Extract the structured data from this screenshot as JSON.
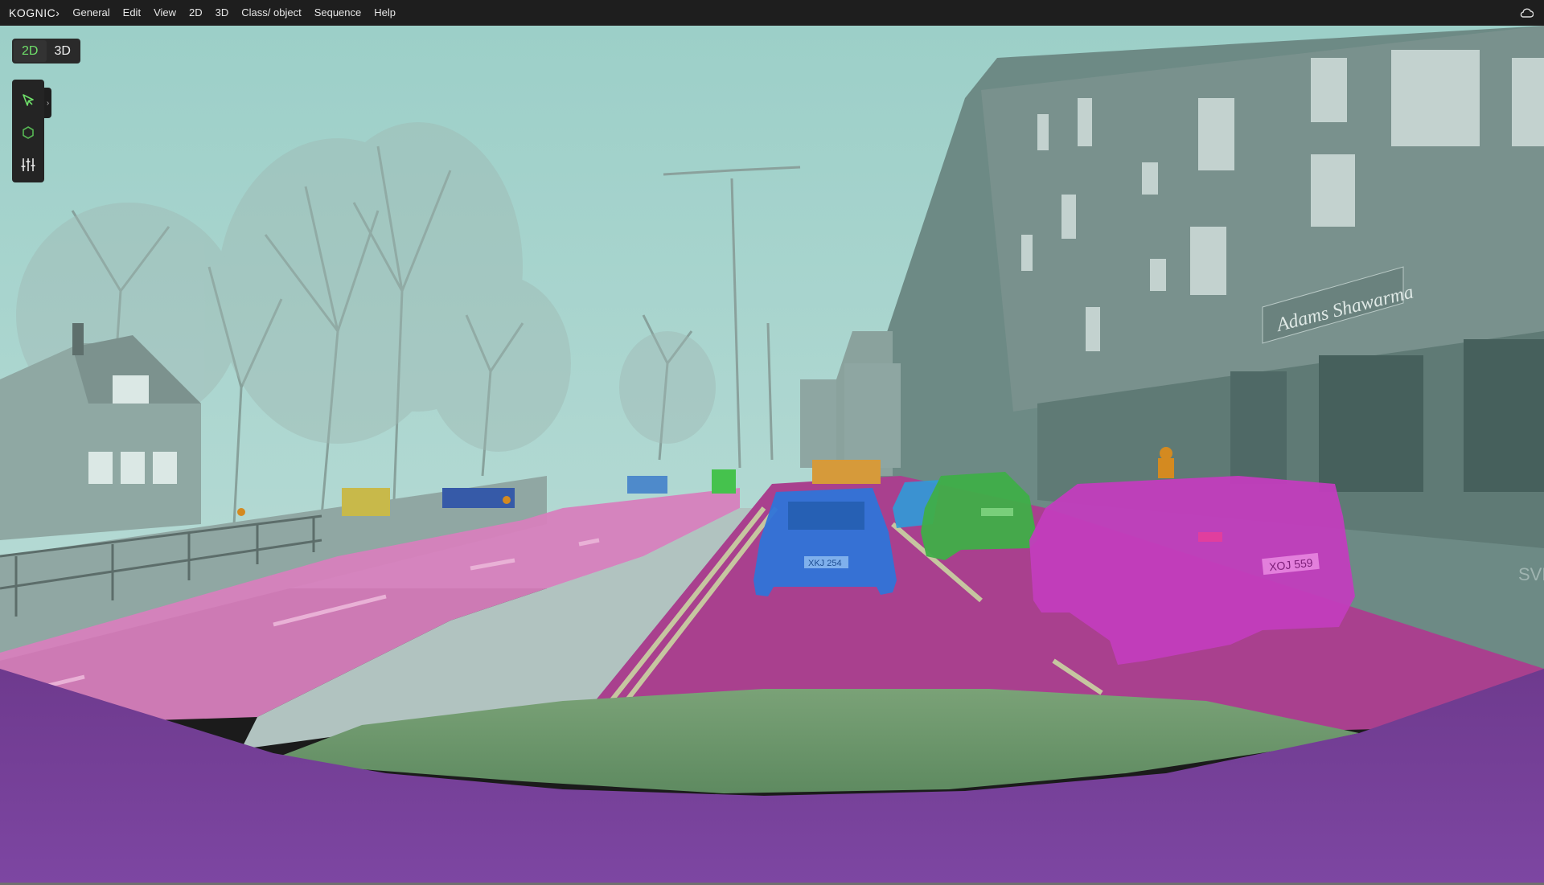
{
  "app": {
    "logo_text": "KOGNIC",
    "menu": [
      "General",
      "Edit",
      "View",
      "2D",
      "3D",
      "Class/ object",
      "Sequence",
      "Help"
    ],
    "cloud_icon": "cloud-icon"
  },
  "mode_toggle": {
    "options": [
      "2D",
      "3D"
    ],
    "active": "2D",
    "active_color": "#6fe06a"
  },
  "tools": [
    {
      "name": "select-tool",
      "icon": "cursor-arrow-icon",
      "active": true
    },
    {
      "name": "polygon-tool",
      "icon": "hexagon-icon",
      "active": false
    },
    {
      "name": "adjust-tool",
      "icon": "sliders-icon",
      "active": false
    }
  ],
  "scene": {
    "description_colors": {
      "sky_overlay": "#a8d6d0",
      "road_pink": "#d678b8",
      "lane_magenta": "#a53a86",
      "ego_purple": "#7b3f9a",
      "hood_green": "#6f9a6c",
      "car_blue": "#2f74d8",
      "car_green": "#3fae48",
      "car_magenta": "#c23dbd",
      "building_tint": "#6f8d88"
    },
    "signage": [
      "Adams Shawarma",
      "SVE"
    ],
    "license_plates": [
      "XKJ 254",
      "XOJ 559"
    ]
  }
}
